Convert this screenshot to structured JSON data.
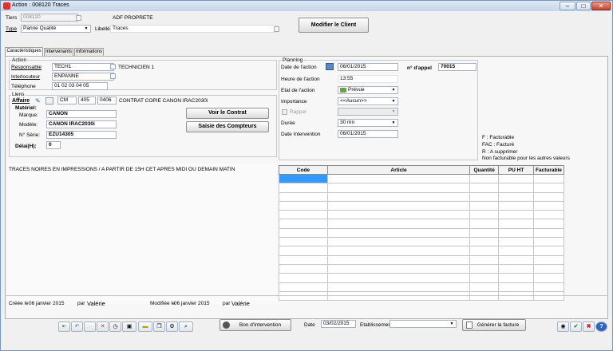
{
  "window": {
    "title": "Action : 008120 Traces"
  },
  "header": {
    "tiers_label": "Tiers",
    "tiers_value": "008120",
    "client_name": "ADF PROPRETE",
    "type_label": "Type",
    "type_value": "Panne Qualité",
    "libelle_label": "Libellé",
    "libelle_value": "Traces",
    "modify_client_label": "Modifier le Client"
  },
  "tabs": [
    "Caractéristiques",
    "Intervenants",
    "Informations"
  ],
  "action": {
    "group_label": "Action",
    "responsable_label": "Responsable",
    "responsable_value": "TECH1",
    "responsable_name": "TECHNICIEN 1",
    "interlocuteur_label": "Interlocuteur",
    "interlocuteur_value": "ENPANNE",
    "telephone_label": "Téléphone",
    "telephone_value": "01 02 03 04 05"
  },
  "liens": {
    "group_label": "Liens",
    "affaire_label": "Affaire",
    "code1": "CM",
    "code2": "405",
    "code3": "0406",
    "contract_text": "CONTRAT COPIE CANON IRAC2030i",
    "materiel_label": "Matériel:",
    "marque_label": "Marque:",
    "marque_value": "CANON",
    "modele_label": "Modèle:",
    "modele_value": "CANON IRAC2030i",
    "serie_label": "N° Série:",
    "serie_value": "EZU14305",
    "delai_label": "Délai(H):",
    "delai_value": "0",
    "voir_contrat_label": "Voir le Contrat",
    "saisie_compteurs_label": "Saisie des Compteurs"
  },
  "planning": {
    "group_label": "Planning",
    "date_action_label": "Date de l'action",
    "date_action_value": "06/01/2015",
    "heure_label": "Heure de l'action",
    "heure_value": "13:55",
    "etat_label": "Etat de l'action",
    "etat_value": "Prévue",
    "importance_label": "Importance",
    "importance_value": "<<Aucun>>",
    "rappel_label": "Rappel",
    "duree_label": "Durée",
    "duree_value": "30 mn",
    "date_intervention_label": "Date Intervention",
    "date_intervention_value": "06/01/2015",
    "appel_label": "n° d'appel",
    "appel_value": "70015"
  },
  "legend": [
    "F : Facturable",
    "FAC : Facturé",
    "R : A supprimer",
    "Non facturable pour les autres valeurs"
  ],
  "notes": {
    "text": "TRACES NOIRES EN IMPRESSIONS / A PARTIR DE 15H CET APRES MIDI OU DEMAIN MATIN"
  },
  "articles_table": {
    "columns": [
      "Code",
      "Article",
      "Quantité",
      "PU HT",
      "Facturable"
    ]
  },
  "footer": {
    "created_label": "Créée le",
    "created_date": "06 janvier 2015",
    "created_by_label": "par",
    "created_by": "Valérie",
    "modified_label": "Modifiée le",
    "modified_date": "06 janvier 2015",
    "modified_by_label": "par",
    "modified_by": "Valérie"
  },
  "bottombar": {
    "bon_label": "Bon d'Intervention",
    "date_label": "Date",
    "date_value": "03/02/2015",
    "etablissement_label": "Etablissement",
    "etablissement_value": "",
    "generer_label": "Générer la facture"
  }
}
